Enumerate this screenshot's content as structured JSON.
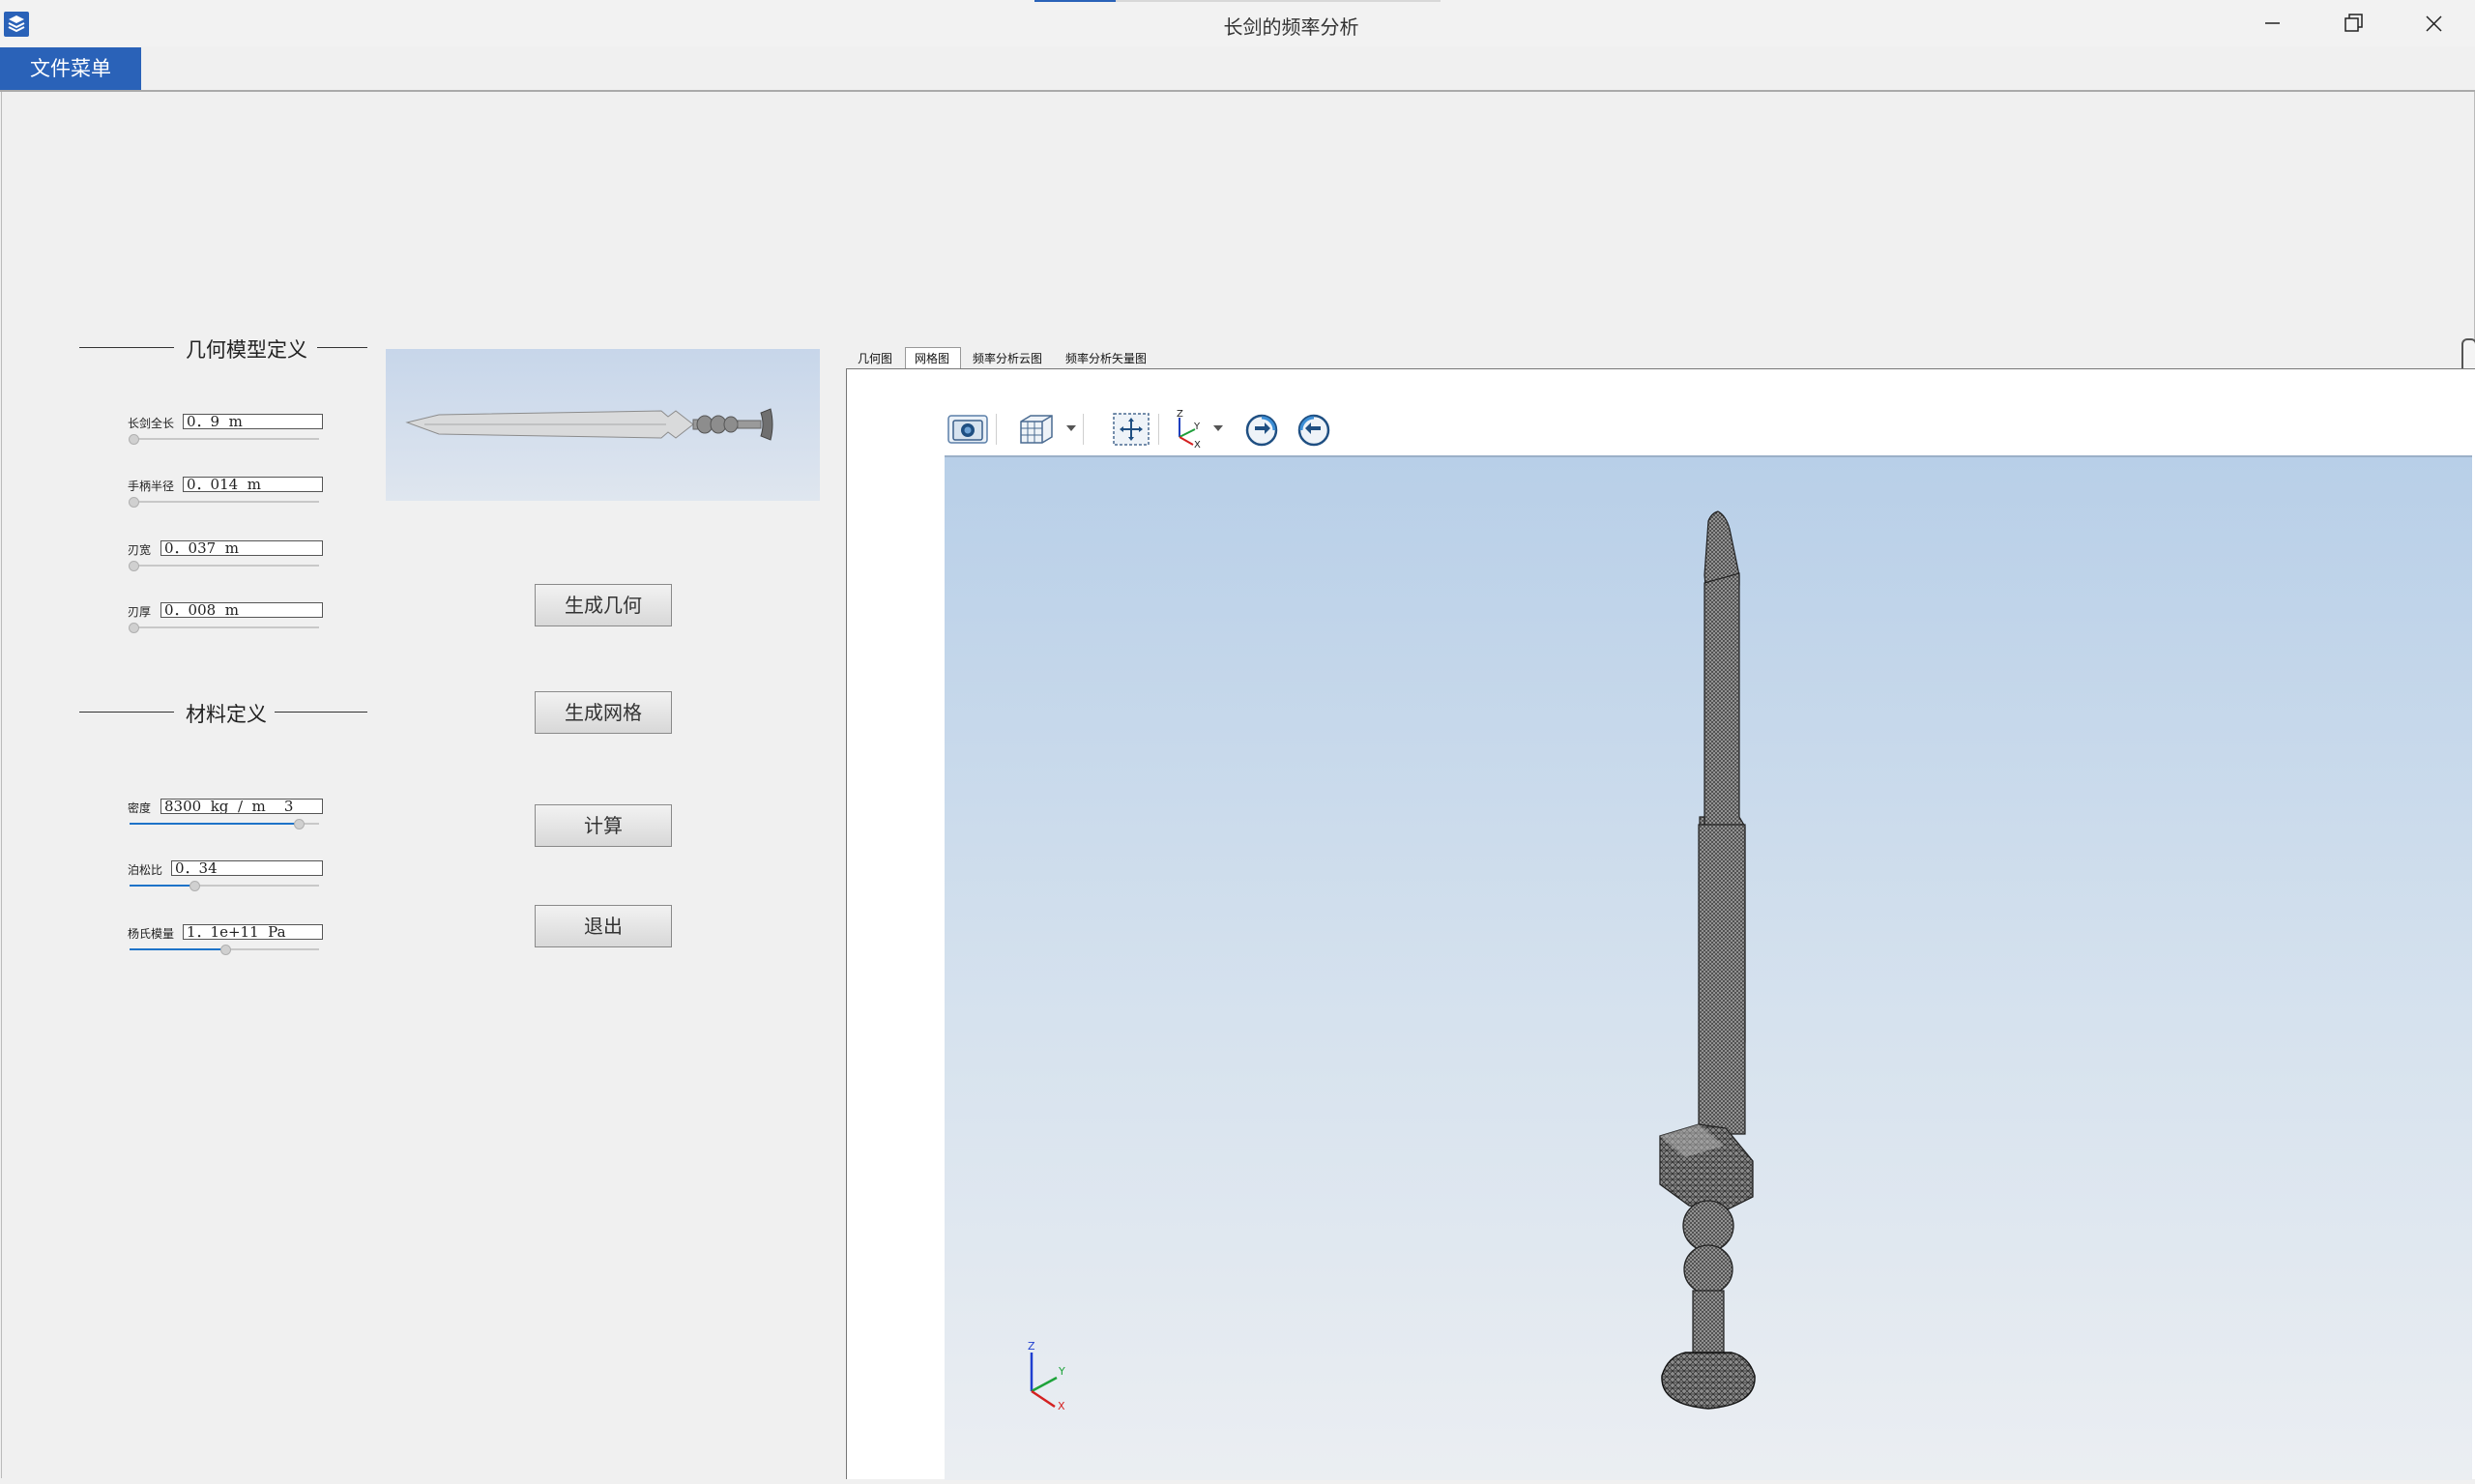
{
  "window": {
    "title": "长剑的频率分析",
    "controls": {
      "minimize": "—",
      "restore": "❐",
      "close": "✕"
    }
  },
  "menu": {
    "file_menu": "文件菜单"
  },
  "geometry_section": {
    "title": "几何模型定义",
    "params": [
      {
        "label": "长剑全长",
        "value": "0．9  m"
      },
      {
        "label": "手柄半径",
        "value": "0．014  m"
      },
      {
        "label": "刃宽",
        "value": "0．037  m"
      },
      {
        "label": "刃厚",
        "value": "0．008  m"
      }
    ]
  },
  "material_section": {
    "title": "材料定义",
    "params": [
      {
        "label": "密度",
        "value": "8300  kg  /  m    3",
        "slider_fraction": 0.89
      },
      {
        "label": "泊松比",
        "value": "0．34",
        "slider_fraction": 0.34
      },
      {
        "label": "杨氏模量",
        "value": "1．1e+11  Pa",
        "slider_fraction": 0.5
      }
    ]
  },
  "actions": {
    "generate_geometry": "生成几何",
    "generate_mesh": "生成网格",
    "compute": "计算",
    "exit": "退出"
  },
  "tabs": [
    "几何图",
    "网格图",
    "频率分析云图",
    "频率分析矢量图"
  ],
  "active_tab": "网格图",
  "toolbar_icons": [
    "camera-icon",
    "view-cube-icon",
    "fit-view-icon",
    "axes-orientation-icon",
    "rotate-cw-icon",
    "rotate-ccw-icon"
  ],
  "axes_triad": {
    "z": "Z",
    "y": "Y",
    "x": "X"
  },
  "colors": {
    "accent": "#2a62b8",
    "slider_fill": "#1e73c8",
    "viewport_top": "#b8cfe8",
    "viewport_bottom": "#ebeef2"
  }
}
